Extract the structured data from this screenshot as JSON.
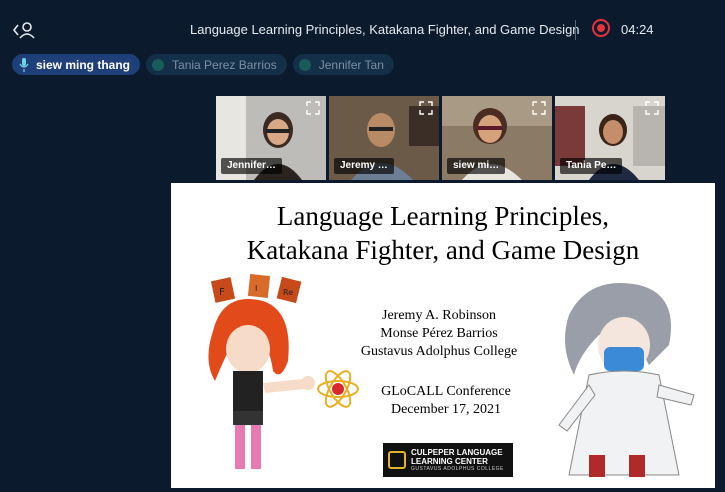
{
  "header": {
    "title": "Language Learning Principles, Katakana Fighter, and Game Design",
    "record_time": "04:24",
    "back_icon": "person-back-icon",
    "record_icon": "record-icon"
  },
  "chips": [
    {
      "name": "siew ming thang",
      "active": true
    },
    {
      "name": "Tania Perez Barrios",
      "active": false
    },
    {
      "name": "Jennifer Tan",
      "active": false
    }
  ],
  "tiles": [
    {
      "label": "Jennifer…",
      "speaking": false
    },
    {
      "label": "Jeremy …",
      "speaking": false
    },
    {
      "label": "siew mi…",
      "speaking": true
    },
    {
      "label": "Tania Pe…",
      "speaking": false
    }
  ],
  "slide": {
    "title_line1": "Language Learning Principles,",
    "title_line2": "Katakana Fighter, and Game Design",
    "author1": "Jeremy A. Robinson",
    "author2": "Monse Pérez Barrios",
    "affiliation": "Gustavus Adolphus College",
    "conference": "GLoCALL Conference",
    "date": "December 17, 2021",
    "logo_line1": "CULPEPER LANGUAGE",
    "logo_line2": "LEARNING CENTER",
    "logo_line3": "GUSTAVUS ADOLPHUS COLLEGE"
  },
  "colors": {
    "background": "#0b1a2c",
    "accent": "#3b7fd1",
    "record": "#e8323c"
  }
}
